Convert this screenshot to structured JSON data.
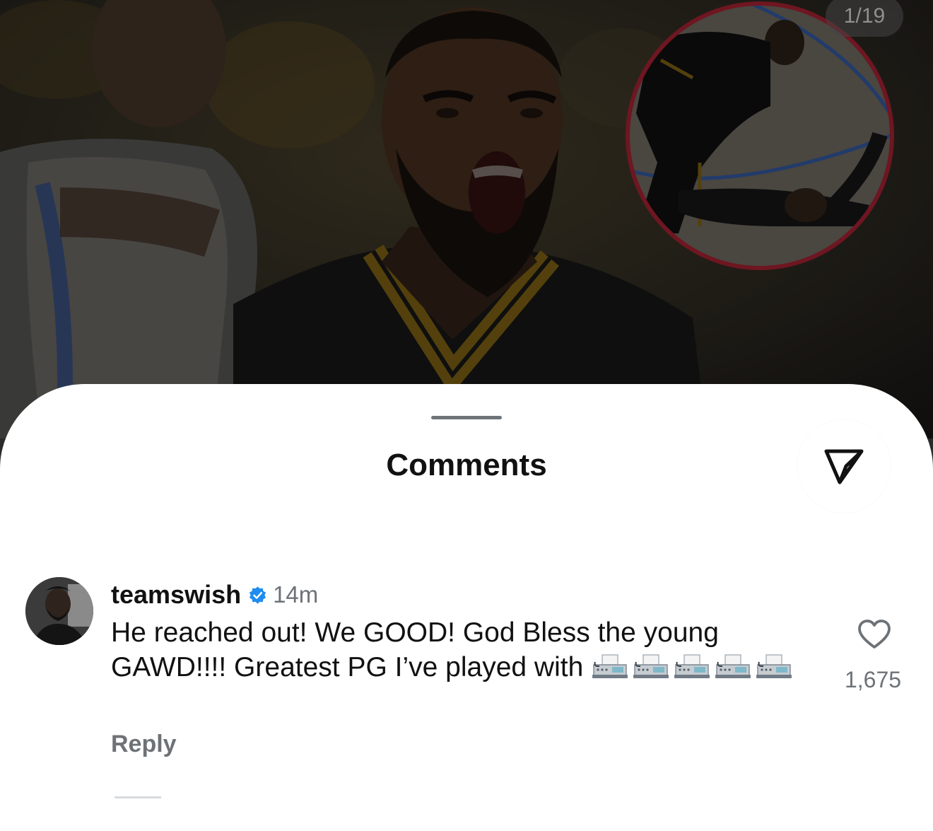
{
  "media": {
    "counter": "1/19"
  },
  "sheet": {
    "title": "Comments",
    "share_icon": "paper-plane-icon"
  },
  "comment": {
    "username": "teamswish",
    "verified_icon": "verified-badge-icon",
    "timestamp": "14m",
    "text": "He reached out! We GOOD! God Bless the young GAWD!!!! Greatest PG I’ve played with",
    "emoji_icon": "fax-machine-emoji",
    "emoji_count": 5,
    "reply_label": "Reply",
    "like_icon": "heart-icon",
    "like_count": "1,675"
  },
  "colors": {
    "accent_blue": "#1f8cf0",
    "muted_text": "#6d7277",
    "title_text": "#111111"
  }
}
